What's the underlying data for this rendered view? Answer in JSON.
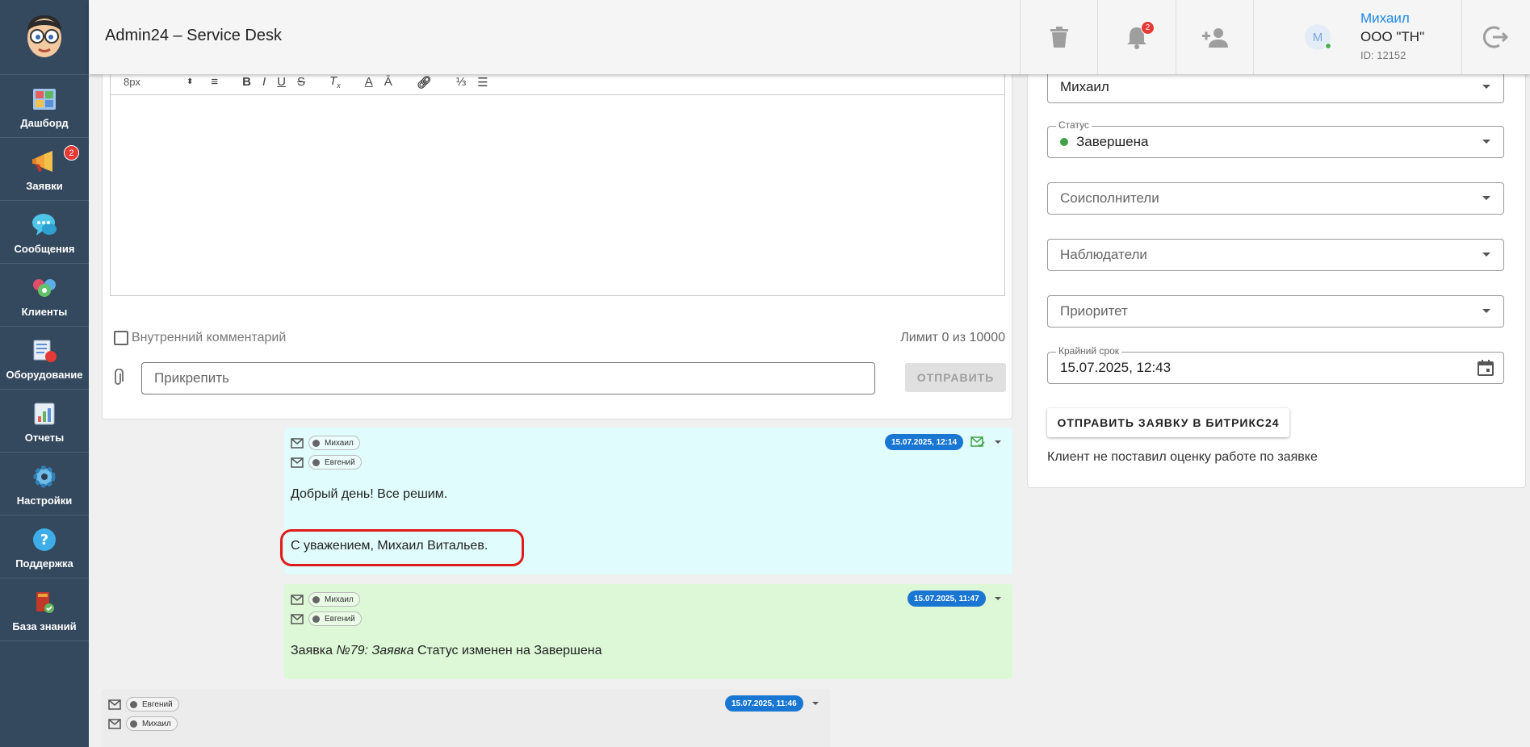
{
  "app": {
    "title": "Admin24 – Service Desk"
  },
  "sidebar": {
    "items": [
      {
        "label": "Дашборд",
        "icon": "dashboard-icon"
      },
      {
        "label": "Заявки",
        "icon": "megaphone-icon",
        "badge": "2"
      },
      {
        "label": "Сообщения",
        "icon": "chat-icon"
      },
      {
        "label": "Клиенты",
        "icon": "clients-icon"
      },
      {
        "label": "Оборудование",
        "icon": "equipment-icon"
      },
      {
        "label": "Отчеты",
        "icon": "reports-icon"
      },
      {
        "label": "Настройки",
        "icon": "gear-icon"
      },
      {
        "label": "Поддержка",
        "icon": "help-icon"
      },
      {
        "label": "База знаний",
        "icon": "book-icon"
      }
    ]
  },
  "topbar": {
    "notifications_badge": "2",
    "user": {
      "name": "Михаил",
      "org": "ООО \"ТН\"",
      "id": "ID: 12152",
      "avatar_letter": "М"
    }
  },
  "editor": {
    "font_size": "8px",
    "internal_comment_label": "Внутренний комментарий",
    "limit_text": "Лимит 0 из 10000",
    "attach_placeholder": "Прикрепить",
    "send_label": "ОТПРАВИТЬ"
  },
  "right_panel": {
    "assignee_value": "Михаил",
    "status_legend": "Статус",
    "status_value": "Завершена",
    "coexecutors_placeholder": "Соисполнители",
    "observers_placeholder": "Наблюдатели",
    "priority_placeholder": "Приоритет",
    "deadline_legend": "Крайний срок",
    "deadline_value": "15.07.2025, 12:43",
    "bitrix_button": "ОТПРАВИТЬ ЗАЯВКУ В БИТРИКС24",
    "rating_text": "Клиент не поставил оценку работе по заявке"
  },
  "messages": [
    {
      "from": "Михаил",
      "to": "Евгений",
      "date": "15.07.2025, 12:14",
      "line1": "Добрый день! Все решим.",
      "line2": "С уважением, Михаил Витальев.",
      "bg": "#e0fcfc"
    },
    {
      "from": "Михаил",
      "to": "Евгений",
      "date": "15.07.2025, 11:47",
      "text_prefix": "Заявка ",
      "text_italic": "№79: Заявка",
      "text_suffix": " Статус изменен на Завершена",
      "bg": "#dcf8d6"
    },
    {
      "from": "Евгений",
      "to": "Михаил",
      "date": "15.07.2025, 11:46",
      "bg": "#ececec"
    }
  ],
  "colors": {
    "sidebar": "#34495e",
    "accent": "#1976d2",
    "badge": "#e53935",
    "highlight": "#e01b1b"
  }
}
